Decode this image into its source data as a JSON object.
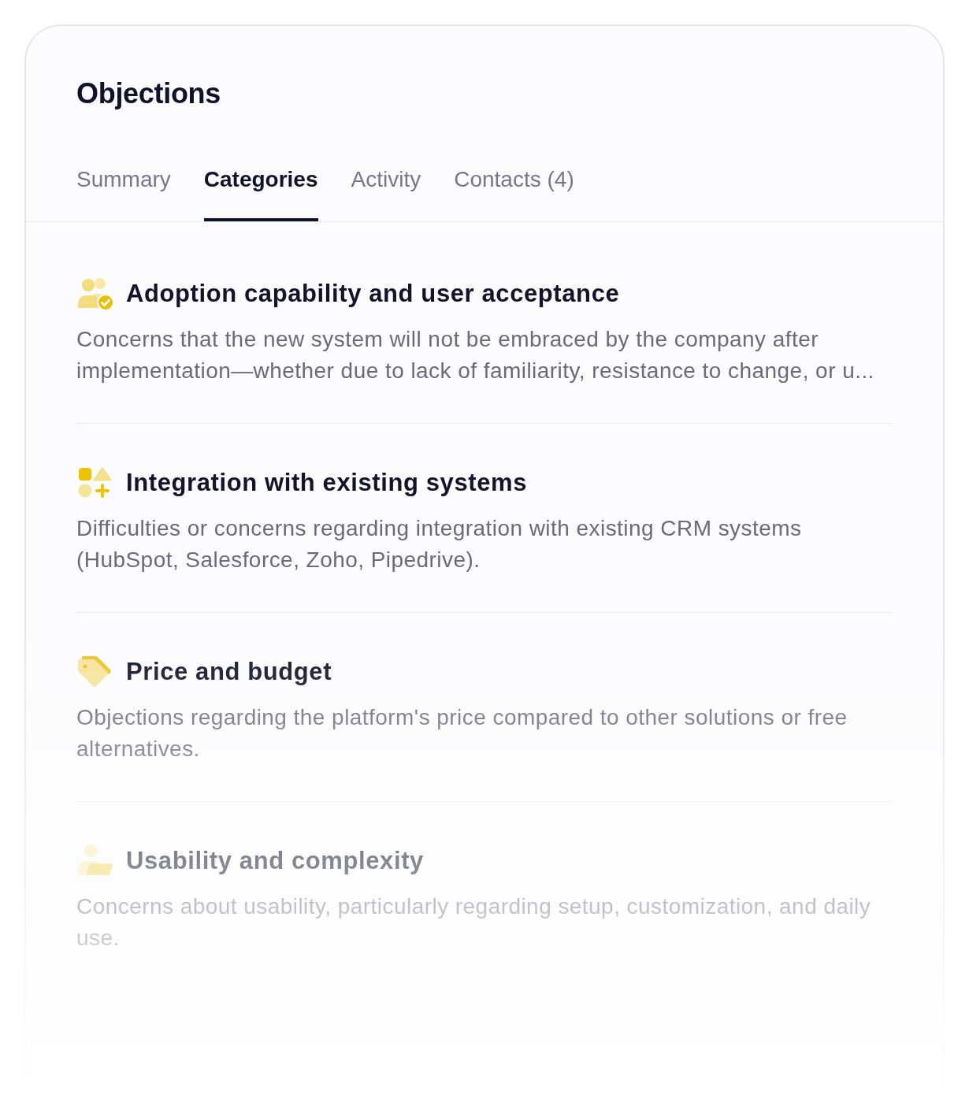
{
  "panel": {
    "title": "Objections"
  },
  "tabs": [
    {
      "label": "Summary",
      "selected": false
    },
    {
      "label": "Categories",
      "selected": true
    },
    {
      "label": "Activity",
      "selected": false
    },
    {
      "label": "Contacts (4)",
      "selected": false
    }
  ],
  "categories": [
    {
      "kind": "people",
      "title": "Adoption capability and user acceptance",
      "description": "Concerns that the new system will not be embraced by the company after implementation—whether due to lack of familiarity, resistance to change, or u..."
    },
    {
      "kind": "shapes",
      "title": "Integration with existing systems",
      "description": "Difficulties or concerns regarding integration with existing CRM systems (HubSpot, Salesforce, Zoho, Pipedrive)."
    },
    {
      "kind": "tag",
      "title": "Price and budget",
      "description": "Objections regarding the platform's price compared to other solutions or free alternatives."
    },
    {
      "kind": "workstation",
      "title": "Usability and complexity",
      "description": "Concerns about usability, particularly regarding setup, customization, and daily use."
    }
  ]
}
